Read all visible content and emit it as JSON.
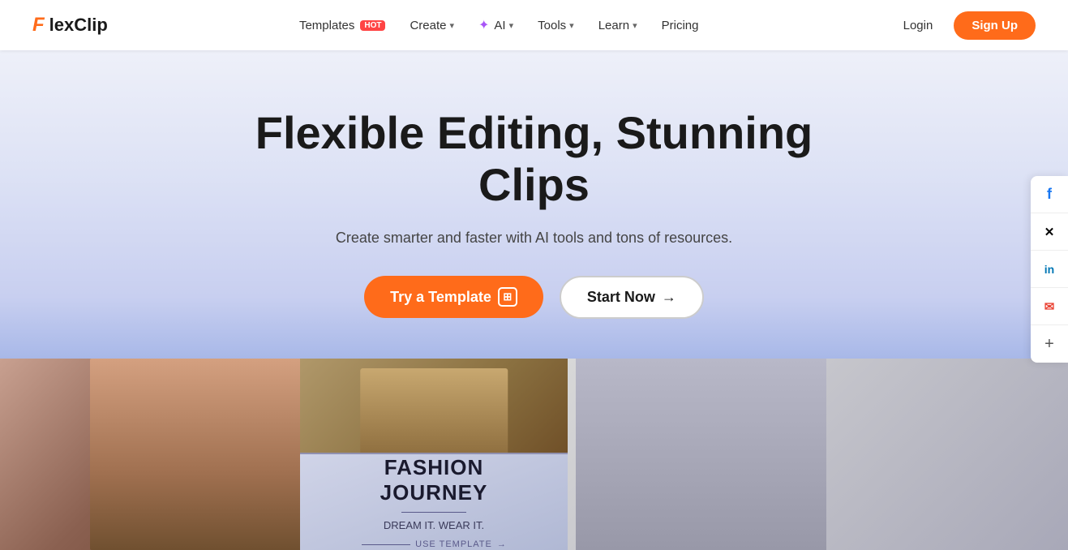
{
  "brand": {
    "logo_letter": "F",
    "logo_text": "lexClip"
  },
  "nav": {
    "items": [
      {
        "id": "templates",
        "label": "Templates",
        "badge": "HOT",
        "has_dropdown": false
      },
      {
        "id": "create",
        "label": "Create",
        "has_dropdown": true
      },
      {
        "id": "ai",
        "label": "AI",
        "has_dropdown": true,
        "has_star": true
      },
      {
        "id": "tools",
        "label": "Tools",
        "has_dropdown": true
      },
      {
        "id": "learn",
        "label": "Learn",
        "has_dropdown": true
      },
      {
        "id": "pricing",
        "label": "Pricing",
        "has_dropdown": false
      }
    ],
    "login_label": "Login",
    "signup_label": "Sign Up"
  },
  "hero": {
    "title": "Flexible Editing, Stunning Clips",
    "subtitle": "Create smarter and faster with AI tools and tons of resources.",
    "try_button": "Try a Template",
    "start_button": "Start Now",
    "start_arrow": "→"
  },
  "fashion_card": {
    "title": "FASHION",
    "title2": "JOURNEY",
    "subtitle": "DREAM IT. WEAR IT."
  },
  "social": [
    {
      "id": "facebook",
      "symbol": "f"
    },
    {
      "id": "twitter-x",
      "symbol": "𝕏"
    },
    {
      "id": "linkedin",
      "symbol": "in"
    },
    {
      "id": "email",
      "symbol": "✉"
    },
    {
      "id": "more",
      "symbol": "+"
    }
  ]
}
